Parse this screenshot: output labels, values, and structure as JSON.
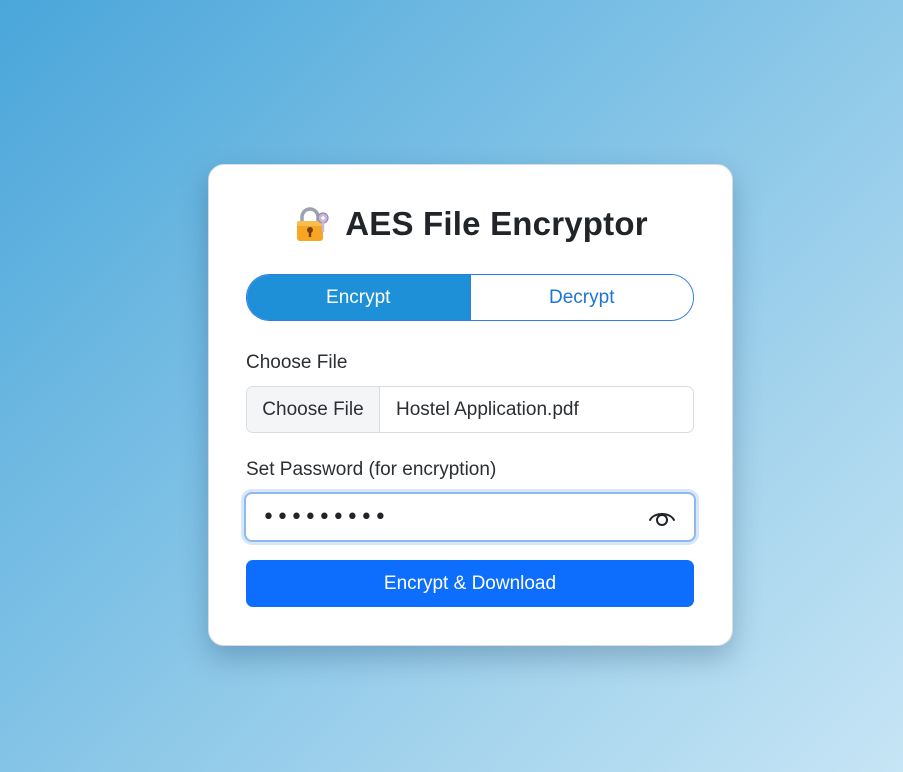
{
  "app": {
    "title": "AES File Encryptor",
    "title_icon": "lock-with-key-icon"
  },
  "mode_switch": {
    "selected": "Encrypt",
    "encrypt_label": "Encrypt",
    "decrypt_label": "Decrypt"
  },
  "file_field": {
    "label": "Choose File",
    "button_label": "Choose File",
    "file_name": "Hostel Application.pdf"
  },
  "password_field": {
    "label": "Set Password (for encryption)",
    "masked_value": "•••••••••",
    "toggle_icon": "eye-icon"
  },
  "submit": {
    "label": "Encrypt & Download"
  },
  "colors": {
    "active_toggle": "#1e90d8",
    "primary_button": "#0d6efd",
    "inactive_text": "#1f74d6"
  }
}
